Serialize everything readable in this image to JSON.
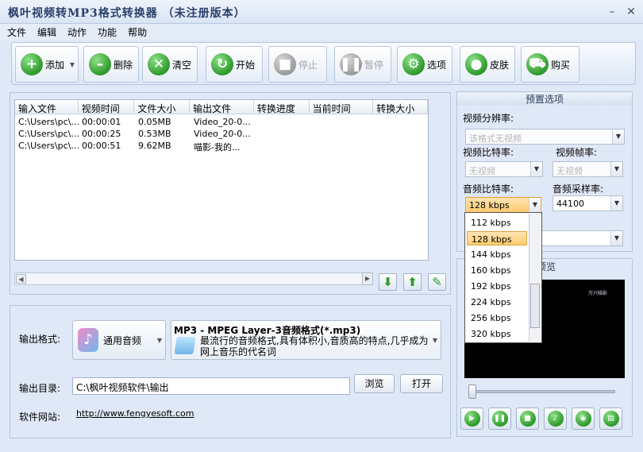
{
  "window": {
    "title": "枫叶视频转MP3格式转换器 （未注册版本）"
  },
  "menu": [
    "文件",
    "编辑",
    "动作",
    "功能",
    "帮助"
  ],
  "toolbar": [
    {
      "label": "添加",
      "icon": "plus-icon",
      "enabled": true
    },
    {
      "label": "删除",
      "icon": "minus-icon",
      "enabled": true
    },
    {
      "label": "清空",
      "icon": "clear-icon",
      "enabled": true
    },
    {
      "label": "开始",
      "icon": "refresh-icon",
      "enabled": true
    },
    {
      "label": "停止",
      "icon": "stop-icon",
      "enabled": false
    },
    {
      "label": "暂停",
      "icon": "pause-icon",
      "enabled": false
    },
    {
      "label": "选项",
      "icon": "options-icon",
      "enabled": true
    },
    {
      "label": "皮肤",
      "icon": "apple-icon",
      "enabled": true
    },
    {
      "label": "购买",
      "icon": "cart-icon",
      "enabled": true
    }
  ],
  "filelist": {
    "columns": [
      "输入文件",
      "视频时间",
      "文件大小",
      "输出文件",
      "转换进度",
      "当前时间",
      "转换大小"
    ],
    "rows": [
      [
        "C:\\Users\\pc\\...",
        "00:00:01",
        "0.05MB",
        "Video_20-0...",
        "",
        "",
        ""
      ],
      [
        "C:\\Users\\pc\\...",
        "00:00:25",
        "0.53MB",
        "Video_20-0...",
        "",
        "",
        ""
      ],
      [
        "C:\\Users\\pc\\...",
        "00:00:51",
        "9.62MB",
        "喵影-我的...",
        "",
        "",
        ""
      ]
    ]
  },
  "output": {
    "format_label": "输出格式:",
    "format_button": "通用音频",
    "format_title": "MP3 - MPEG Layer-3音频格式(*.mp3)",
    "format_desc": "最流行的音频格式,具有体积小,音质高的特点,几乎成为网上音乐的代名词",
    "dir_label": "输出目录:",
    "dir_value": "C:\\枫叶视频软件\\输出",
    "browse": "浏览",
    "open": "打开",
    "site_label": "软件网站:",
    "site_url": "http://www.fengyesoft.com"
  },
  "preset": {
    "title": "预置选项",
    "video_res_label": "视频分辨率:",
    "video_res_value": "该格式无视频",
    "video_bitrate_label": "视频比特率:",
    "video_bitrate_value": "无视频",
    "video_fps_label": "视频帧率:",
    "video_fps_value": "无视频",
    "audio_bitrate_label": "音频比特率:",
    "audio_bitrate_value": "128 kbps",
    "audio_sample_label": "音频采样率:",
    "audio_sample_value": "44100",
    "dropdown": [
      "112 kbps",
      "128 kbps",
      "144 kbps",
      "160 kbps",
      "192 kbps",
      "224 kbps",
      "256 kbps",
      "320 kbps"
    ],
    "dropdown_selected": "128 kbps"
  },
  "preview": {
    "title_partial": "预览",
    "screen_logo": "万兴喵影"
  },
  "colors": {
    "panel_bg": "#dfe8f6",
    "green": "#2d9a2a",
    "highlight": "#ffcd70"
  }
}
